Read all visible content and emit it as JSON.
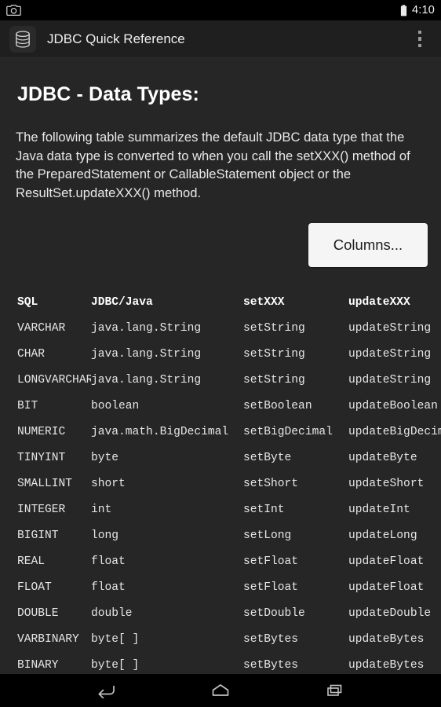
{
  "status_bar": {
    "notification_icon": "camera-icon",
    "battery_icon": "battery-icon",
    "clock": "4:10"
  },
  "app_bar": {
    "app_icon": "database-icon",
    "title": "JDBC Quick Reference",
    "overflow_icon": "overflow-menu-icon"
  },
  "content": {
    "page_title": "JDBC - Data Types:",
    "intro_paragraph": "The following table summarizes the default JDBC data type that the Java data type is converted to when you call the setXXX() method of the PreparedStatement or CallableStatement object or the ResultSet.updateXXX() method.",
    "columns_button": "Columns..."
  },
  "table": {
    "headers": {
      "sql": "SQL",
      "java": "JDBC/Java",
      "set": "setXXX",
      "update": "updateXXX"
    },
    "rows": [
      {
        "sql": "VARCHAR",
        "java": "java.lang.String",
        "set": "setString",
        "update": "updateString"
      },
      {
        "sql": "CHAR",
        "java": "java.lang.String",
        "set": "setString",
        "update": "updateString"
      },
      {
        "sql": "LONGVARCHAR",
        "java": "java.lang.String",
        "set": "setString",
        "update": "updateString"
      },
      {
        "sql": "BIT",
        "java": "boolean",
        "set": "setBoolean",
        "update": "updateBoolean"
      },
      {
        "sql": "NUMERIC",
        "java": "java.math.BigDecimal",
        "set": "setBigDecimal",
        "update": "updateBigDecimal"
      },
      {
        "sql": "TINYINT",
        "java": "byte",
        "set": "setByte",
        "update": "updateByte"
      },
      {
        "sql": "SMALLINT",
        "java": "short",
        "set": "setShort",
        "update": "updateShort"
      },
      {
        "sql": "INTEGER",
        "java": "int",
        "set": "setInt",
        "update": "updateInt"
      },
      {
        "sql": "BIGINT",
        "java": "long",
        "set": "setLong",
        "update": "updateLong"
      },
      {
        "sql": "REAL",
        "java": "float",
        "set": "setFloat",
        "update": "updateFloat"
      },
      {
        "sql": "FLOAT",
        "java": "float",
        "set": "setFloat",
        "update": "updateFloat"
      },
      {
        "sql": "DOUBLE",
        "java": "double",
        "set": "setDouble",
        "update": "updateDouble"
      },
      {
        "sql": "VARBINARY",
        "java": "byte[ ]",
        "set": "setBytes",
        "update": "updateBytes"
      },
      {
        "sql": "BINARY",
        "java": "byte[ ]",
        "set": "setBytes",
        "update": "updateBytes"
      }
    ]
  },
  "nav_bar": {
    "back": "back-icon",
    "home": "home-icon",
    "recents": "recents-icon"
  },
  "colors": {
    "background": "#262626",
    "app_bar": "#1f1f1f",
    "system_bar": "#000000",
    "text_primary": "#ffffff",
    "text_secondary": "#e6e6e6",
    "button_face": "#f5f5f5",
    "button_text": "#1c1c1c"
  }
}
